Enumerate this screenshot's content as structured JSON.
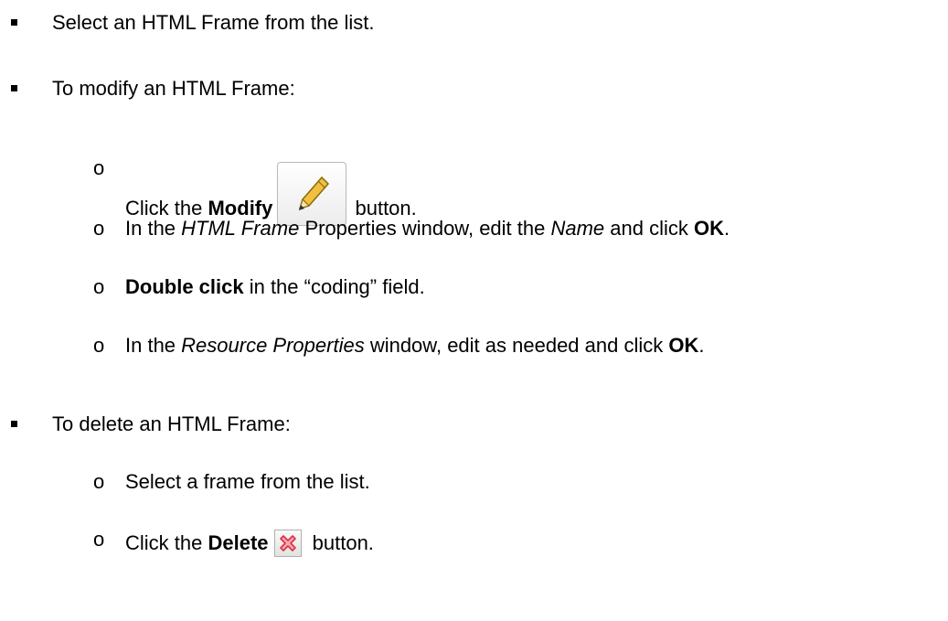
{
  "items": {
    "select_frame": "Select an HTML Frame from the list.",
    "modify_heading": "To modify an HTML Frame:",
    "modify_click_pre": "Click the ",
    "modify_click_bold": "Modify",
    "modify_click_post": " button.",
    "props_pre": "In the ",
    "props_italic": "HTML Frame",
    "props_mid": " Properties window, edit the ",
    "props_name": "Name",
    "props_and": " and click ",
    "props_ok": "OK",
    "props_end": ".",
    "dbl_bold": "Double click",
    "dbl_rest": " in the “coding” field.",
    "res_pre": "In the ",
    "res_italic": "Resource Properties",
    "res_mid": " window, edit as needed and click ",
    "res_ok": "OK",
    "res_end": ".",
    "delete_heading": "To delete an HTML Frame:",
    "select_from_list": "Select a frame from the list.",
    "delete_click_pre": "Click the ",
    "delete_click_bold": "Delete",
    "delete_click_post": " button."
  },
  "bullets": {
    "level2_marker": "o"
  },
  "icons": {
    "modify": "pencil-icon",
    "delete": "red-x-icon"
  },
  "colors": {
    "pencil_body": "#f0c040",
    "pencil_outline": "#8a6a10",
    "delete_red": "#e03040"
  }
}
